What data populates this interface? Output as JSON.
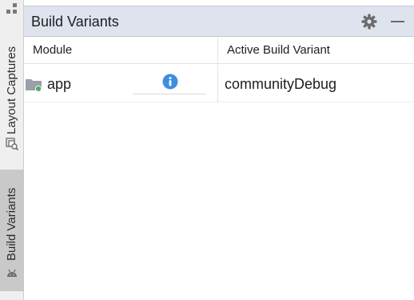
{
  "sidebar": {
    "items": [
      {
        "label": "Layout Captures",
        "icon": "layout-inspector-icon",
        "selected": false
      },
      {
        "label": "Build Variants",
        "icon": "android-icon",
        "selected": true
      }
    ]
  },
  "panel": {
    "title": "Build Variants",
    "actions": [
      {
        "icon": "gear-icon"
      },
      {
        "icon": "minimize-icon"
      }
    ]
  },
  "table": {
    "headers": [
      "Module",
      "Active Build Variant"
    ],
    "rows": [
      {
        "module": "app",
        "module_icon": "android-module-folder-icon",
        "info_icon": "info-icon",
        "variant": "communityDebug"
      }
    ]
  },
  "colors": {
    "header_bg": "#dfe3ee",
    "info_blue": "#3d8ee0",
    "module_green": "#59a869",
    "strip_bg": "#efefef",
    "selected_tab_bg": "#c9c9c9"
  }
}
